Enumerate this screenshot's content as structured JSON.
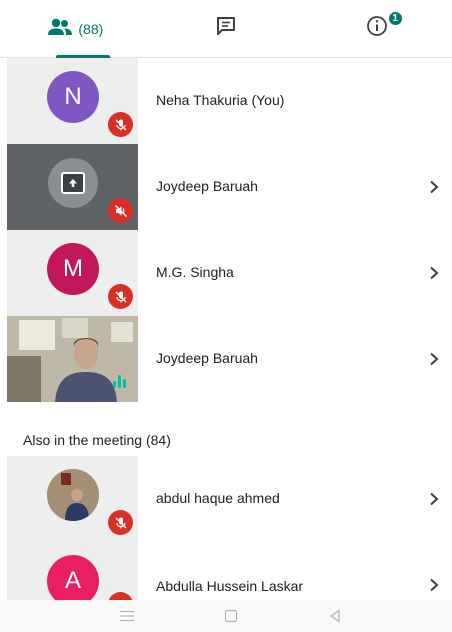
{
  "tabs": {
    "people": {
      "count_label": "(88)"
    },
    "chat": {
      "badge": "1"
    },
    "info": {}
  },
  "participants": [
    {
      "name": "Neha Thakuria (You)",
      "avatar_letter": "N",
      "avatar_color": "#7e57c2",
      "status": "muted"
    },
    {
      "name": "Joydeep Baruah",
      "status": "presenting-muted"
    },
    {
      "name": "M.G. Singha",
      "avatar_letter": "M",
      "avatar_color": "#c2185b",
      "status": "muted"
    },
    {
      "name": "Joydeep Baruah",
      "status": "speaking"
    }
  ],
  "also_in_meeting": {
    "label": "Also in the meeting (84)",
    "participants": [
      {
        "name": "abdul haque ahmed",
        "status": "muted"
      },
      {
        "name": "Abdulla Hussein Laskar",
        "avatar_letter": "A",
        "avatar_color": "#e91e63",
        "status": "muted"
      }
    ]
  },
  "colors": {
    "accent": "#00796b",
    "muted_red": "#d93025",
    "speaking": "#00bfa5"
  },
  "icons": {
    "people_tab": "people-icon",
    "chat_tab": "chat-icon",
    "info_tab": "info-icon",
    "nav": [
      "menu-icon",
      "home-icon",
      "back-icon"
    ]
  }
}
